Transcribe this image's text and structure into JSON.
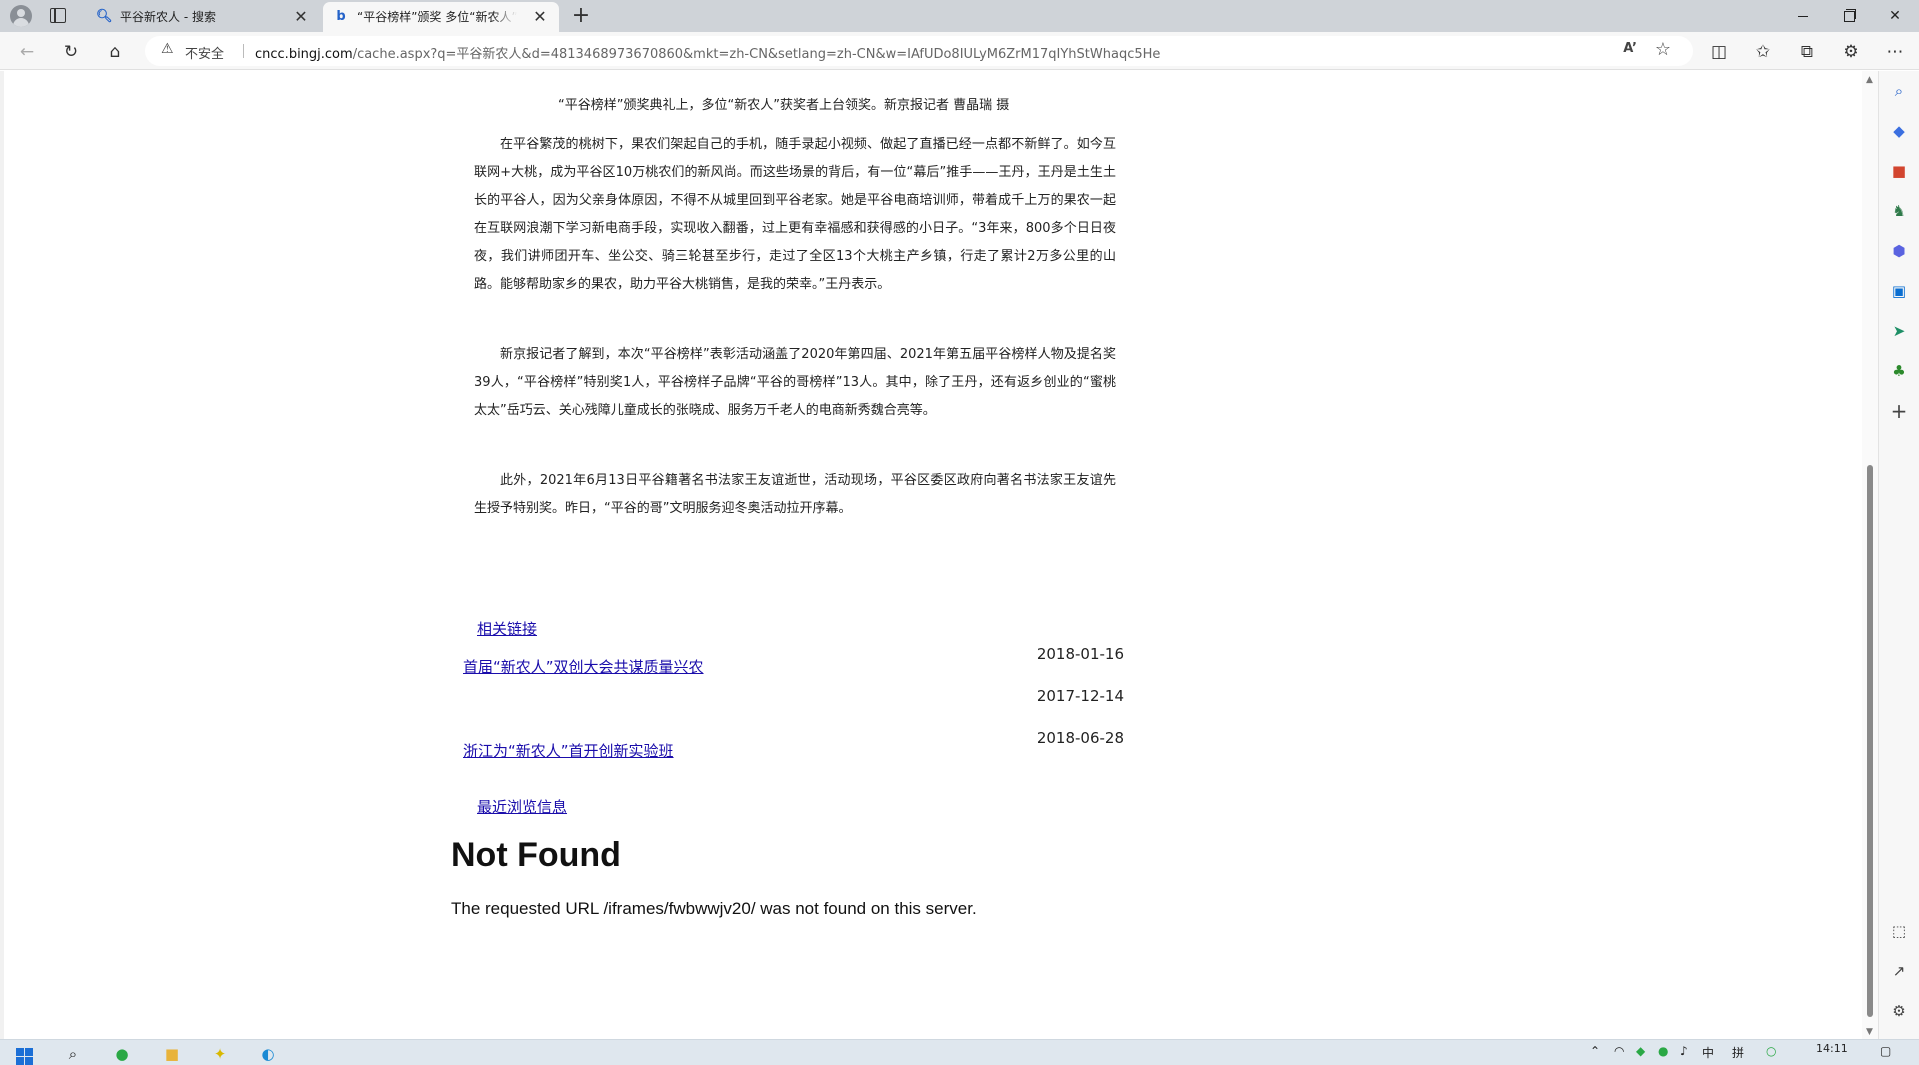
{
  "browser": {
    "tabs": [
      {
        "title": "平谷新农人 - 搜索",
        "favicon": "search-icon"
      },
      {
        "title": "“平谷榜样”颁奖 多位“新农人”获奖",
        "favicon": "bing-icon"
      }
    ],
    "address": {
      "security_label": "不安全",
      "url_host": "cncc.bingj.com",
      "url_rest": "/cache.aspx?q=平谷新农人&d=4813468973670860&mkt=zh-CN&setlang=zh-CN&w=IAfUDo8IULyM6ZrM17qIYhStWhaqc5He"
    }
  },
  "article": {
    "caption": "“平谷榜样”颁奖典礼上，多位“新农人”获奖者上台领奖。新京报记者 曹晶瑞 摄",
    "paragraphs": [
      "在平谷繁茂的桃树下，果农们架起自己的手机，随手录起小视频、做起了直播已经一点都不新鲜了。如今互联网+大桃，成为平谷区10万桃农们的新风尚。而这些场景的背后，有一位“幕后”推手——王丹，王丹是土生土长的平谷人，因为父亲身体原因，不得不从城里回到平谷老家。她是平谷电商培训师，带着成千上万的果农一起在互联网浪潮下学习新电商手段，实现收入翻番，过上更有幸福感和获得感的小日子。“3年来，800多个日日夜夜，我们讲师团开车、坐公交、骑三轮甚至步行，走过了全区13个大桃主产乡镇，行走了累计2万多公里的山路。能够帮助家乡的果农，助力平谷大桃销售，是我的荣幸。”王丹表示。",
      "新京报记者了解到，本次“平谷榜样”表彰活动涵盖了2020年第四届、2021年第五届平谷榜样人物及提名奖39人，“平谷榜样”特别奖1人，平谷榜样子品牌“平谷的哥榜样”13人。其中，除了王丹，还有返乡创业的“蜜桃太太”岳巧云、关心残障儿童成长的张晓成、服务万千老人的电商新秀魏合亮等。",
      "此外，2021年6月13日平谷籍著名书法家王友谊逝世，活动现场，平谷区委区政府向著名书法家王友谊先生授予特别奖。昨日，“平谷的哥”文明服务迎冬奥活动拉开序幕。"
    ]
  },
  "related": {
    "heading": "相关链接",
    "links": [
      {
        "text": "首届“新农人”双创大会共谋质量兴农"
      },
      {
        "text": "浙江为“新农人”首开创新实验班"
      }
    ],
    "dates": [
      "2018-01-16",
      "2017-12-14",
      "2018-06-28"
    ],
    "recent_heading": "最近浏览信息"
  },
  "error": {
    "title": "Not Found",
    "message": "The requested URL /iframes/fwbwwjv20/ was not found on this server."
  },
  "taskbar": {
    "ime": "中",
    "ime_mode": "拼",
    "time": "14:11"
  },
  "colors": {
    "link": "#1a0dab",
    "tabstrip": "#cfd3d8",
    "toolbar": "#f7f7f7",
    "taskbar": "#dfe7ee"
  }
}
